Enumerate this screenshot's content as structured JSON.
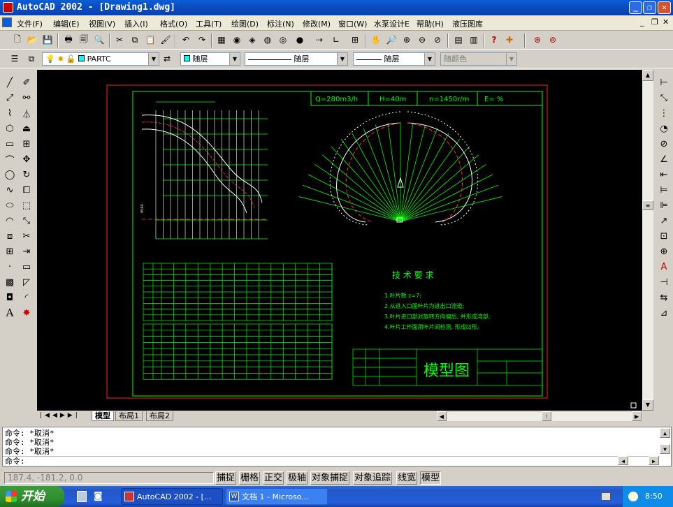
{
  "window": {
    "title": "AutoCAD 2002 - [Drawing1.dwg]"
  },
  "menu": [
    "文件(F)",
    "编辑(E)",
    "视图(V)",
    "插入(I)",
    "格式(O)",
    "工具(T)",
    "绘图(D)",
    "标注(N)",
    "修改(M)",
    "窗口(W)",
    "水泵设计E",
    "帮助(H)",
    "液压图库"
  ],
  "properties_bar": {
    "layer": "PARTC",
    "color": "随层",
    "linetype": "随层",
    "lineweight": "随层",
    "plotstyle": "随颜色"
  },
  "drawing": {
    "header": {
      "q": "Q=280m3/h",
      "h": "H=40m",
      "n": "n=1450r/m",
      "e": "E=  %"
    },
    "tech_title": "技 术 要 求",
    "tech_items": [
      "1.叶片数 z=7;",
      "2.从进入口面叶片为进出口流道;",
      "3.叶片进口部对旋转方向偏后, 并形成湾部;",
      "4.叶片工作面用叶片间检测, 形成凹形。"
    ],
    "title_block": "模型图"
  },
  "layout_tabs": [
    "模型",
    "布局1",
    "布局2"
  ],
  "command_lines": [
    "命令: *取消*",
    "命令: *取消*",
    "命令: *取消*",
    "命令:"
  ],
  "status": {
    "coords": "187.4, -181.2, 0.0",
    "buttons": [
      "捕捉",
      "栅格",
      "正交",
      "极轴",
      "对象捕捉",
      "对象追踪",
      "线宽",
      "模型"
    ]
  },
  "taskbar": {
    "start": "开始",
    "tasks": [
      "AutoCAD 2002 - [...",
      "文档 1 - Microso..."
    ],
    "time": "8:50"
  }
}
